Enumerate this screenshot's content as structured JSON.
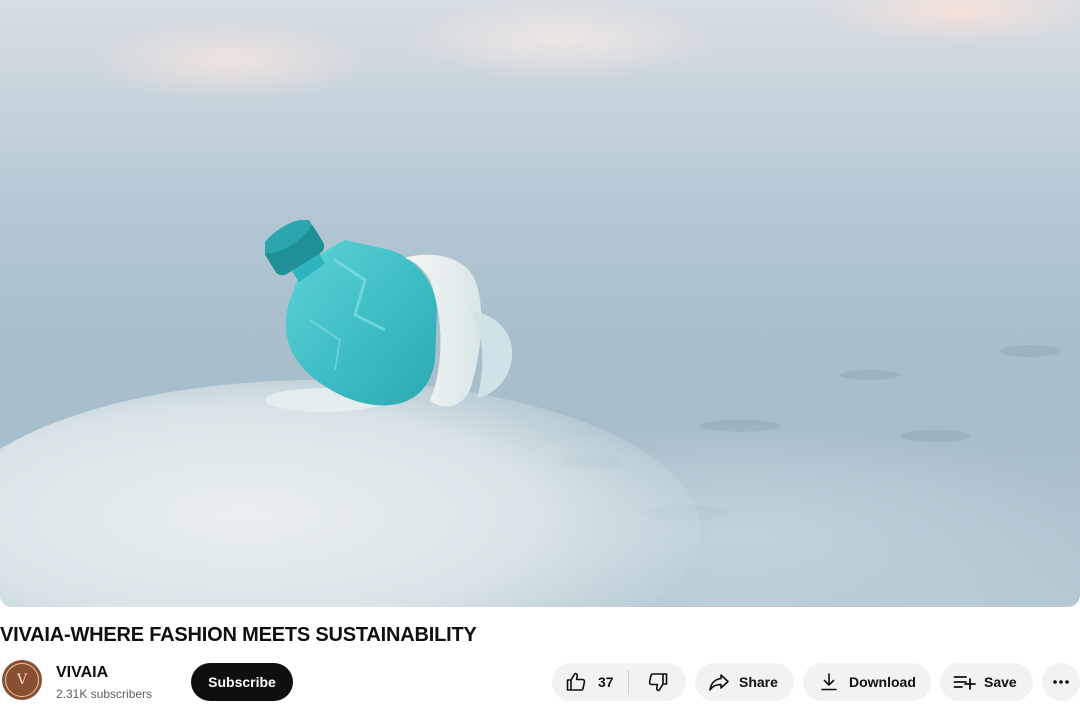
{
  "video": {
    "title": "VIVAIA-WHERE FASHION MEETS SUSTAINABILITY"
  },
  "channel": {
    "name": "VIVAIA",
    "subscribers": "2.31K subscribers",
    "avatar_letter": "V",
    "avatar_color": "#8a4e33"
  },
  "actions": {
    "subscribe_label": "Subscribe",
    "like_count": "37",
    "share_label": "Share",
    "download_label": "Download",
    "save_label": "Save"
  },
  "icons": {
    "like": "thumbs-up-icon",
    "dislike": "thumbs-down-icon",
    "share": "share-arrow-icon",
    "download": "download-icon",
    "save": "playlist-add-icon",
    "more": "more-horizontal-icon"
  },
  "colors": {
    "subscribe_bg": "#0f0f0f",
    "pill_bg": "#f2f2f2",
    "text": "#0f0f0f",
    "secondary_text": "#606060"
  }
}
